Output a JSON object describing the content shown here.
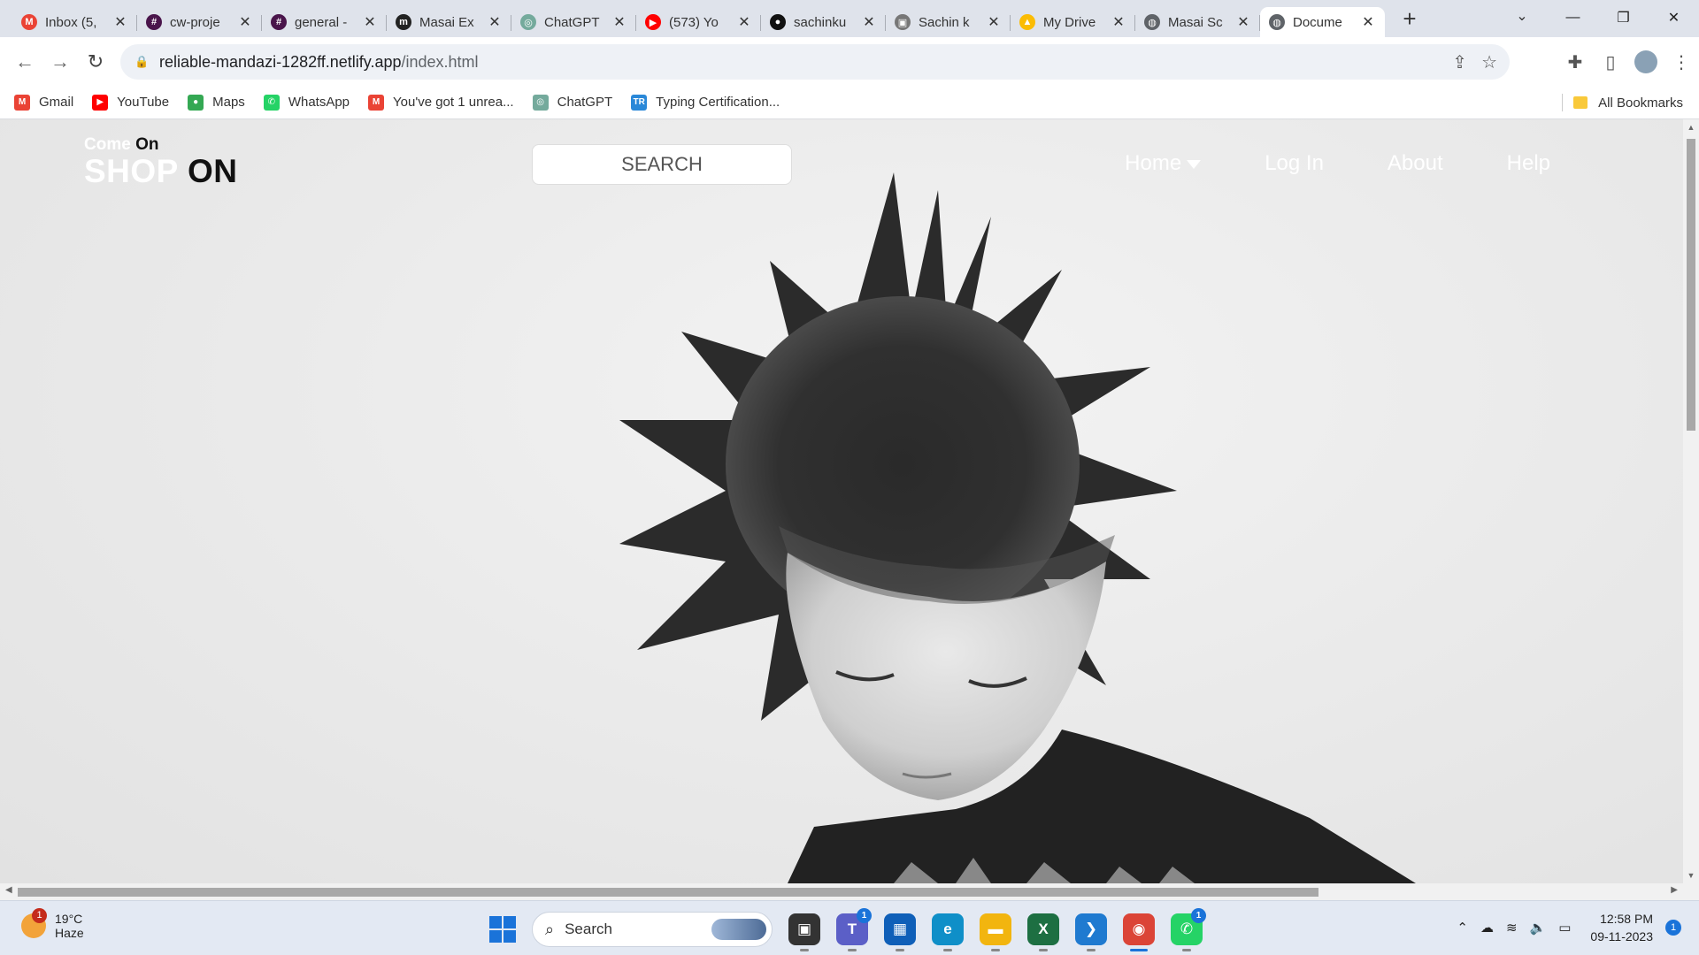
{
  "browser": {
    "tabs": [
      {
        "label": "Inbox (5,",
        "icon": "gmail-icon",
        "color": "#ea4335",
        "glyph": "M"
      },
      {
        "label": "cw-proje",
        "icon": "slack-icon",
        "color": "#4a154b",
        "glyph": "#"
      },
      {
        "label": "general -",
        "icon": "slack-icon",
        "color": "#4a154b",
        "glyph": "#"
      },
      {
        "label": "Masai Ex",
        "icon": "masai-icon",
        "color": "#222222",
        "glyph": "m"
      },
      {
        "label": "ChatGPT",
        "icon": "chatgpt-icon",
        "color": "#74aa9c",
        "glyph": "◎"
      },
      {
        "label": "(573) Yo",
        "icon": "youtube-icon",
        "color": "#ff0000",
        "glyph": "▶"
      },
      {
        "label": "sachinku",
        "icon": "github-icon",
        "color": "#111111",
        "glyph": "●"
      },
      {
        "label": "Sachin k",
        "icon": "image-icon",
        "color": "#777777",
        "glyph": "▣"
      },
      {
        "label": "My Drive",
        "icon": "google-drive-icon",
        "color": "#fbbc04",
        "glyph": "▲"
      },
      {
        "label": "Masai Sc",
        "icon": "globe-icon",
        "color": "#5f6368",
        "glyph": "◍"
      },
      {
        "label": "Docume",
        "icon": "globe-icon",
        "color": "#5f6368",
        "glyph": "◍",
        "active": true
      }
    ],
    "new_tab": "+",
    "tab_close": "✕",
    "tab_search": "⌄",
    "window_controls": {
      "minimize": "—",
      "restore": "❐",
      "close": "✕"
    },
    "url": {
      "host": "reliable-mandazi-1282ff.netlify.app",
      "path": "/index.html"
    },
    "bookmarks": [
      {
        "label": "Gmail",
        "color": "#ea4335",
        "glyph": "M"
      },
      {
        "label": "YouTube",
        "color": "#ff0000",
        "glyph": "▶"
      },
      {
        "label": "Maps",
        "color": "#34a853",
        "glyph": "●"
      },
      {
        "label": "WhatsApp",
        "color": "#25d366",
        "glyph": "✆"
      },
      {
        "label": "You've got 1 unrea...",
        "color": "#ea4335",
        "glyph": "M"
      },
      {
        "label": "ChatGPT",
        "color": "#74aa9c",
        "glyph": "◎"
      },
      {
        "label": "Typing Certification...",
        "color": "#2a88d8",
        "glyph": "TR"
      }
    ],
    "all_bookmarks": "All Bookmarks"
  },
  "site": {
    "brand": {
      "small_light": "Come",
      "small_dark": "On",
      "big_light": "SHOP",
      "big_dark": "ON"
    },
    "search_label": "SEARCH",
    "nav": {
      "home": "Home",
      "login": "Log In",
      "about": "About",
      "help": "Help"
    }
  },
  "taskbar": {
    "weather": {
      "temp": "19°C",
      "condition": "Haze",
      "badge": "1"
    },
    "search_label": "Search",
    "apps": [
      {
        "name": "task-view-icon",
        "color": "#333333",
        "glyph": "▣"
      },
      {
        "name": "teams-icon",
        "color": "#5b5fc7",
        "glyph": "T",
        "badge": "1"
      },
      {
        "name": "store-icon",
        "color": "#0f5fb8",
        "glyph": "▦"
      },
      {
        "name": "edge-icon",
        "color": "#0f8fc8",
        "glyph": "e"
      },
      {
        "name": "file-explorer-icon",
        "color": "#f2b50f",
        "glyph": "▬"
      },
      {
        "name": "excel-icon",
        "color": "#1d6f42",
        "glyph": "X"
      },
      {
        "name": "vscode-icon",
        "color": "#1f7ad0",
        "glyph": "❯"
      },
      {
        "name": "chrome-icon",
        "color": "#db4437",
        "glyph": "◉",
        "focused": true
      },
      {
        "name": "whatsapp-icon",
        "color": "#25d366",
        "glyph": "✆",
        "badge": "1"
      }
    ],
    "clock": {
      "time": "12:58 PM",
      "date": "09-11-2023"
    },
    "notification_count": "1"
  }
}
